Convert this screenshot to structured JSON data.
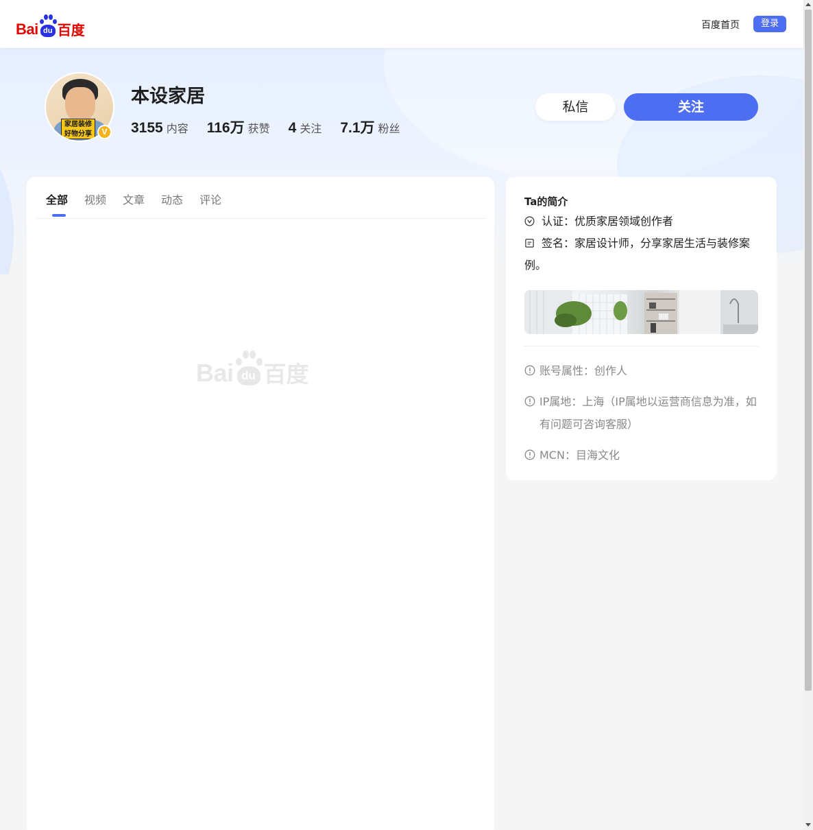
{
  "header": {
    "logo": {
      "latin": "Bai",
      "paw": "du",
      "chinese": "百度"
    },
    "home_link": "百度首页",
    "login_label": "登录"
  },
  "profile": {
    "name": "本设家居",
    "avatar_tag": "家居装修好物分享",
    "verified_badge": "V",
    "stats": [
      {
        "value": "3155",
        "label": "内容"
      },
      {
        "value": "116万",
        "label": "获赞"
      },
      {
        "value": "4",
        "label": "关注"
      },
      {
        "value": "7.1万",
        "label": "粉丝"
      }
    ],
    "message_label": "私信",
    "follow_label": "关注"
  },
  "tabs": [
    {
      "label": "全部",
      "active": true
    },
    {
      "label": "视频",
      "active": false
    },
    {
      "label": "文章",
      "active": false
    },
    {
      "label": "动态",
      "active": false
    },
    {
      "label": "评论",
      "active": false
    }
  ],
  "placeholder_logo": {
    "latin": "Bai",
    "paw": "du",
    "chinese": "百度"
  },
  "intro": {
    "title": "Ta的简介",
    "certification": "认证：优质家居领域创作者",
    "signature": "签名：家居设计师，分享家居生活与装修案例。",
    "account_type": "账号属性：创作人",
    "ip_location": "IP属地：上海（IP属地以运营商信息为准，如有问题可咨询客服）",
    "mcn": "MCN：目海文化"
  },
  "colors": {
    "brand_blue": "#4e6ef2",
    "baidu_red": "#e10601",
    "baidu_paw_blue": "#2932e1"
  }
}
